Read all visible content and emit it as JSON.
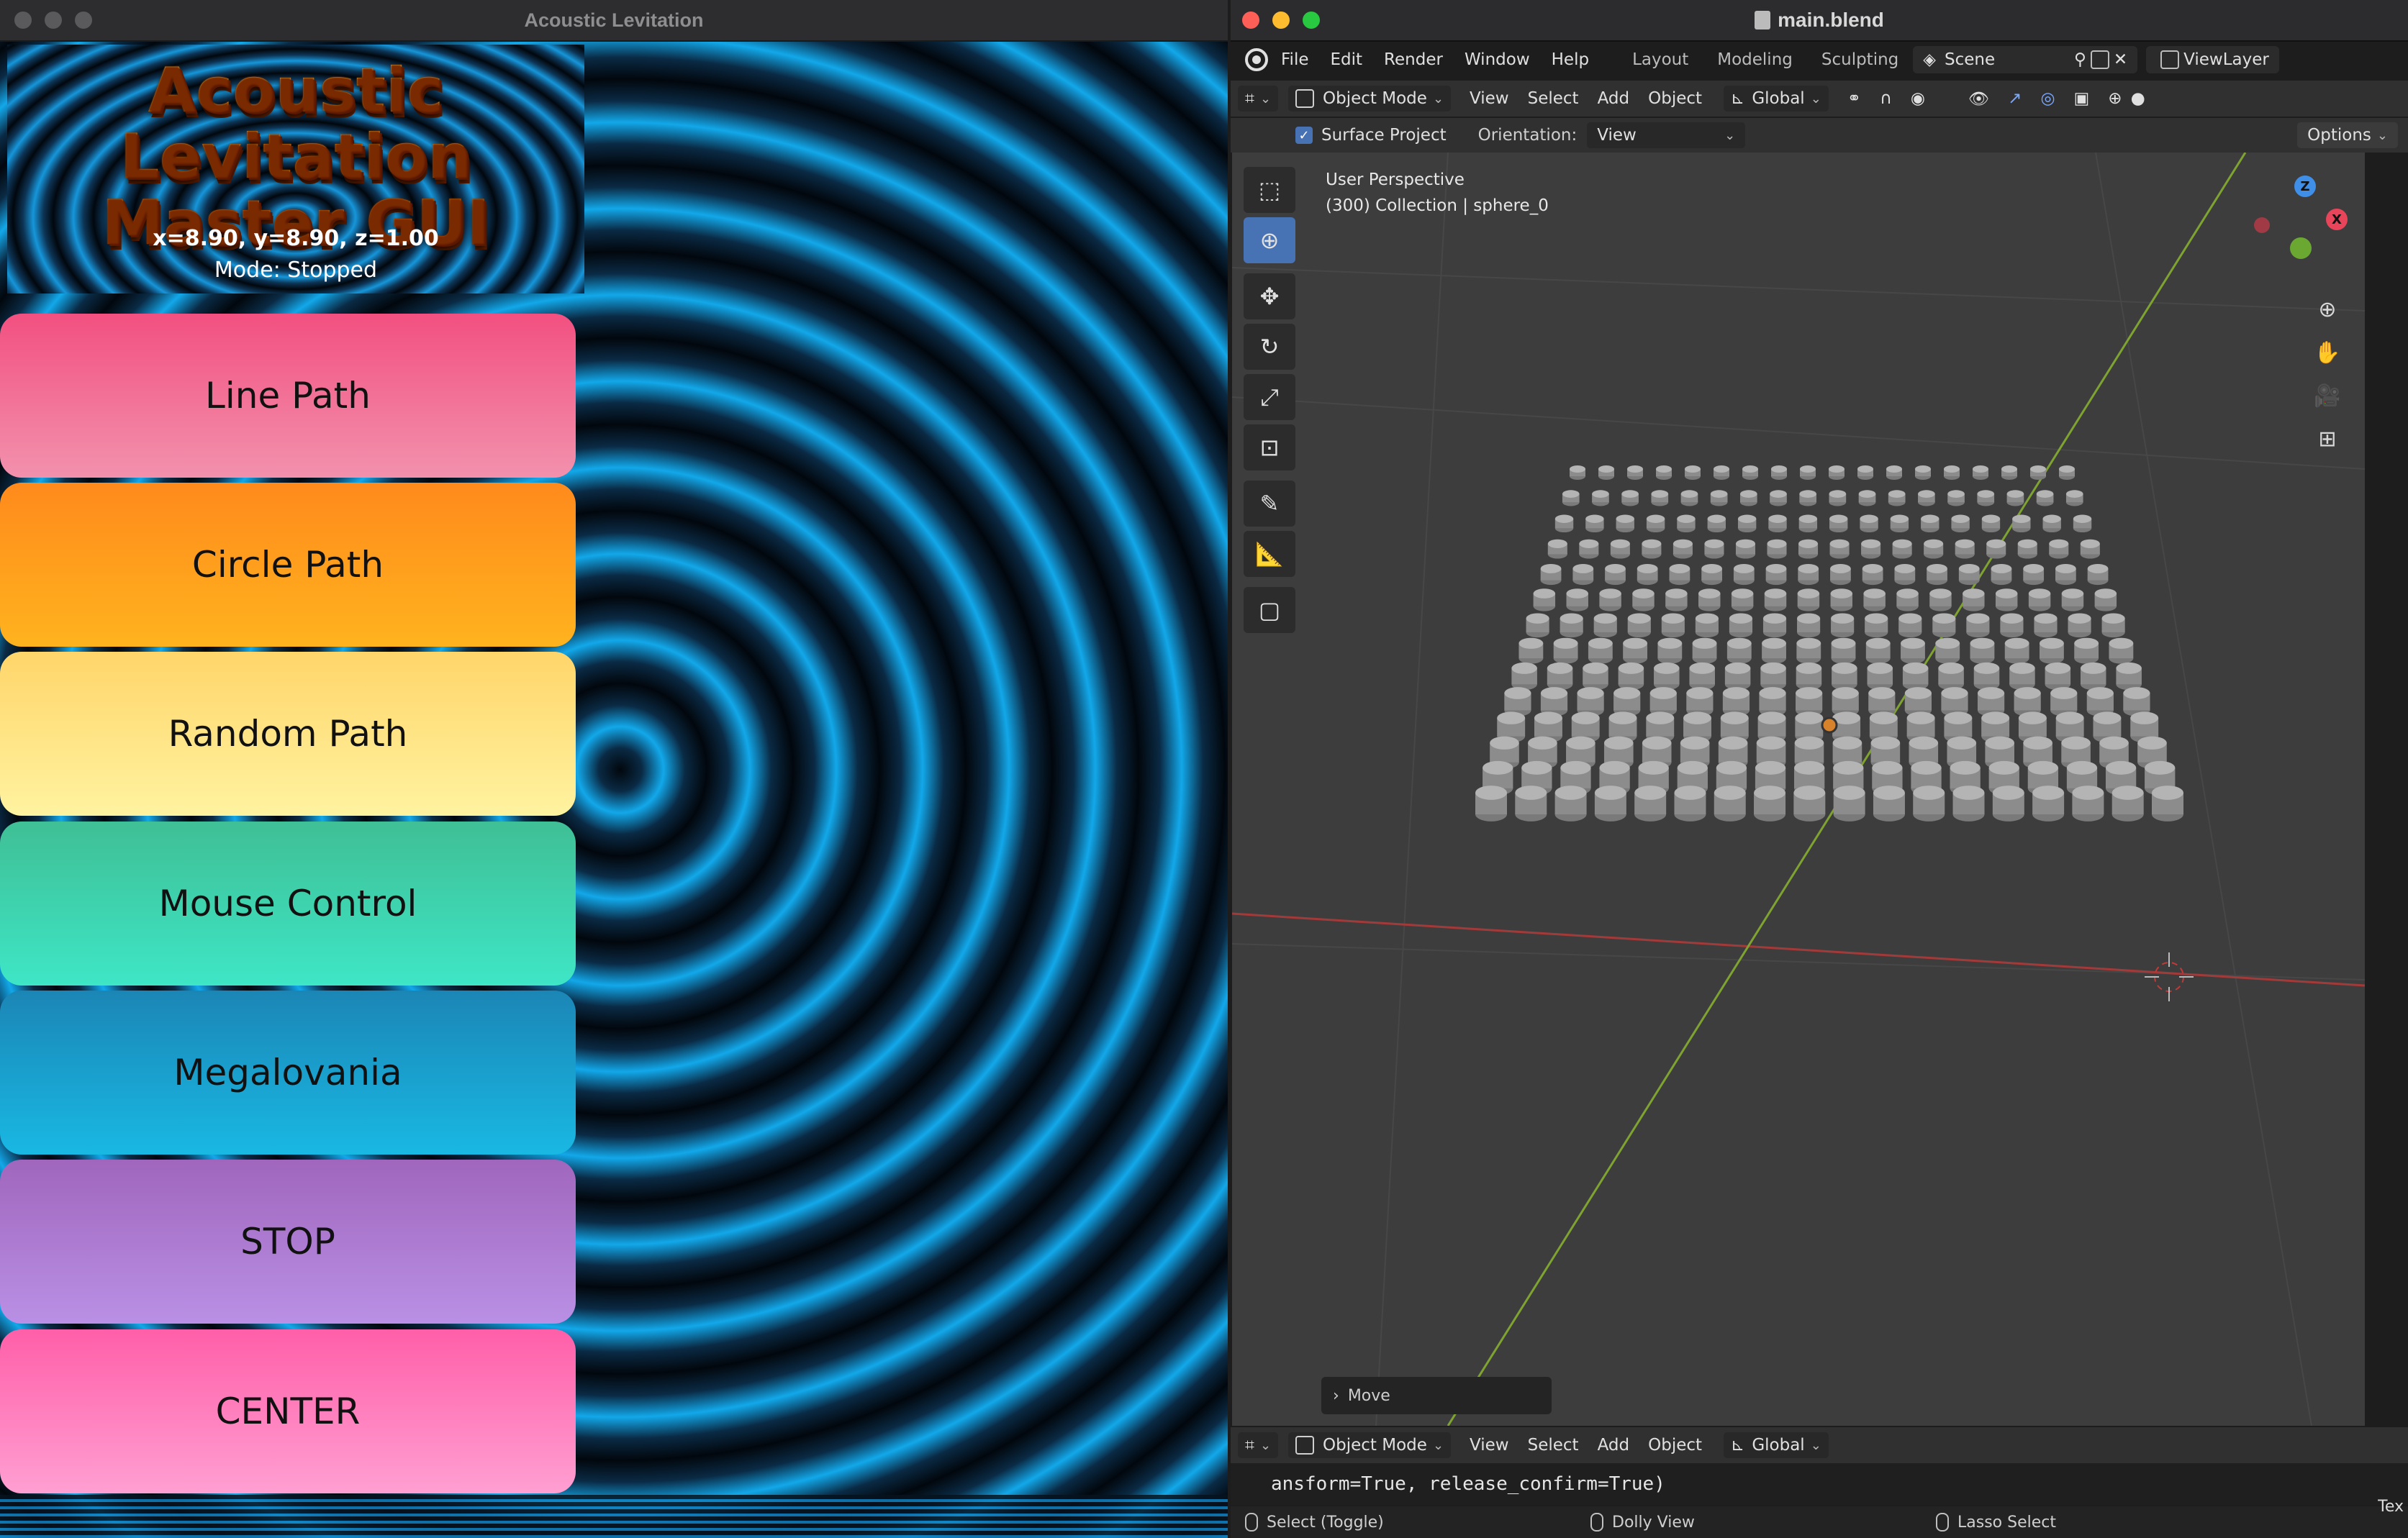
{
  "left_window": {
    "title": "Acoustic Levitation",
    "app_title_line1": "Acoustic Levitation",
    "app_title_line2": "Master GUI",
    "coords": "x=8.90, y=8.90, z=1.00",
    "mode": "Mode: Stopped",
    "buttons": [
      {
        "label": "Line Path",
        "color": "#f25080"
      },
      {
        "label": "Circle Path",
        "color": "#ff9a1e"
      },
      {
        "label": "Random Path",
        "color": "#ffe07a"
      },
      {
        "label": "Mouse Control",
        "color": "#3dd6b0"
      },
      {
        "label": "Megalovania",
        "color": "#1aa6d4"
      },
      {
        "label": "STOP",
        "color": "#a877d0"
      },
      {
        "label": "CENTER",
        "color": "#ff75b8"
      }
    ]
  },
  "right_window": {
    "title": "main.blend",
    "menu": [
      "File",
      "Edit",
      "Render",
      "Window",
      "Help"
    ],
    "workspaces": [
      "Layout",
      "Modeling",
      "Sculpting"
    ],
    "scene": "Scene",
    "view_layer": "ViewLayer",
    "header3d": {
      "mode": "Object Mode",
      "menus": [
        "View",
        "Select",
        "Add",
        "Object"
      ],
      "orientation": "Global"
    },
    "tool_settings": {
      "surface_project": "Surface Project",
      "orientation_label": "Orientation:",
      "orientation_value": "View",
      "options": "Options"
    },
    "viewport": {
      "perspective": "User Perspective",
      "collection": "(300) Collection | sphere_0",
      "move_panel": "Move"
    },
    "gizmo": {
      "z": "Z",
      "x": "X",
      "y": ""
    },
    "console_text": "ansform=True, release_confirm=True)",
    "status": [
      "Select (Toggle)",
      "Dolly View",
      "Lasso Select"
    ],
    "truncated_right": "Tex",
    "accent": "#4772b3"
  }
}
